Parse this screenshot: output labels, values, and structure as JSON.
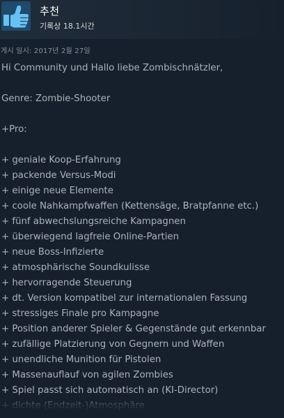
{
  "header": {
    "verdict": "추천",
    "hours": "기록상 18.1시간",
    "thumb_icon": "thumbs-up-icon"
  },
  "posted": "게시 일시: 2017년 2월 27일",
  "review": {
    "lines": [
      "Hi Community und Hallo liebe Zombischnätzler,",
      "",
      "Genre: Zombie-Shooter",
      "",
      "+Pro:",
      "",
      "+ geniale Koop-Erfahrung",
      "+ packende Versus-Modi",
      "+ einige neue Elemente",
      "+ coole Nahkampfwaffen (Kettensäge, Bratpfanne etc.)",
      "+ fünf abwechslungsreiche Kampagnen",
      "+ überwiegend lagfreie Online-Partien",
      "+ neue Boss-Infizierte",
      "+ atmosphärische Soundkulisse",
      "+ hervorragende Steuerung",
      "+ dt. Version kompatibel zur internationalen Fassung",
      "+ stressiges Finale pro Kampagne",
      "+ Position anderer Spieler & Gegenstände gut erkennbar",
      "+ zufällige Platzierung von Gegnern und Waffen",
      "+ unendliche Munition für Pistolen",
      "+ Massenauflauf von agilen Zombies",
      "+ Spiel passt sich automatisch an (KI-Director)",
      "+ dichte (Endzeit-)Atmosphäre"
    ]
  },
  "colors": {
    "background": "#16202d",
    "thumb_bg": "#1f4a6b",
    "thumb_icon": "#67c1f5",
    "text": "#acb2b8",
    "date": "#8091a2"
  }
}
